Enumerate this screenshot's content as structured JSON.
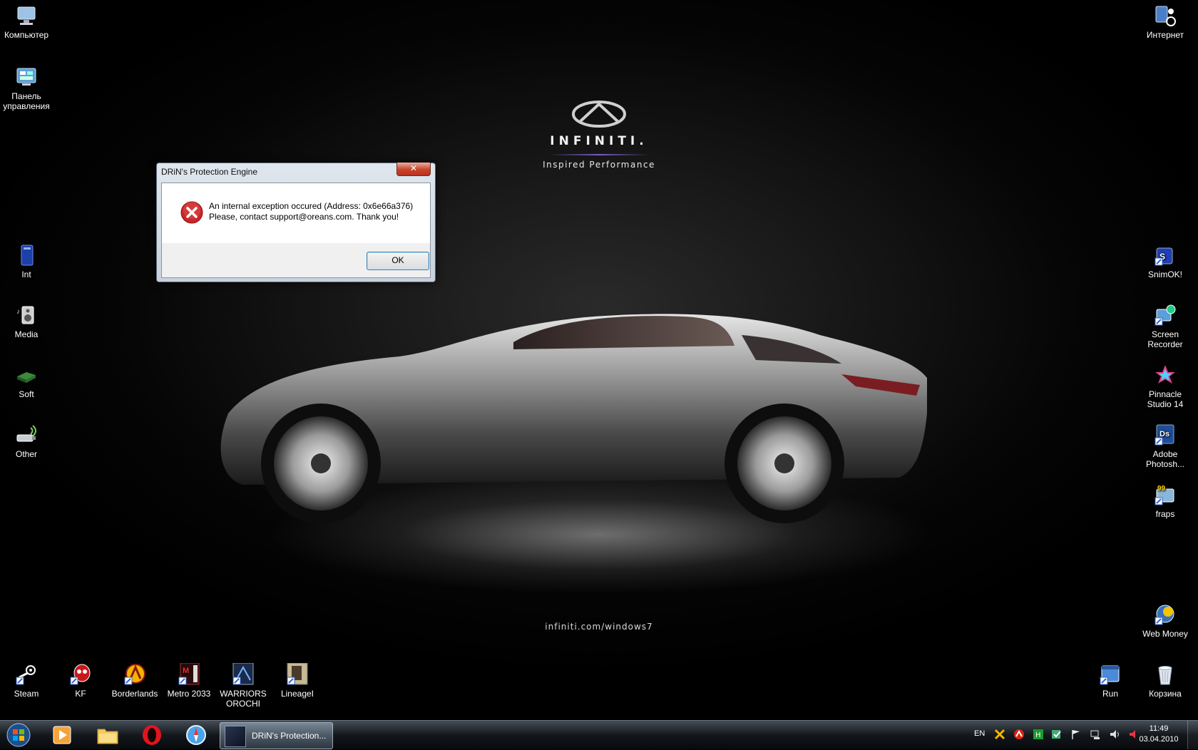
{
  "wallpaper": {
    "brand": "INFINITI.",
    "tagline": "Inspired Performance",
    "url": "infiniti.com/windows7"
  },
  "desktop_icons_left": [
    {
      "label": "Компьютер",
      "icon": "computer-icon"
    },
    {
      "label": "Панель управления",
      "icon": "control-panel-icon"
    },
    {
      "label": "Int",
      "icon": "folder-int-icon"
    },
    {
      "label": "Media",
      "icon": "media-speaker-icon"
    },
    {
      "label": "Soft",
      "icon": "soft-drive-icon"
    },
    {
      "label": "Other",
      "icon": "usb-wireless-icon"
    }
  ],
  "desktop_icons_right": [
    {
      "label": "Интернет",
      "icon": "internet-network-icon"
    },
    {
      "label": "SnimOK!",
      "icon": "snimok-icon"
    },
    {
      "label": "Screen Recorder",
      "icon": "screen-recorder-icon"
    },
    {
      "label": "Pinnacle Studio 14",
      "icon": "pinnacle-studio-icon"
    },
    {
      "label": "Adobe Photosh...",
      "icon": "photoshop-icon"
    },
    {
      "label": "fraps",
      "icon": "fraps-icon"
    },
    {
      "label": "Web Money",
      "icon": "webmoney-icon"
    },
    {
      "label": "Run",
      "icon": "run-icon"
    },
    {
      "label": "Корзина",
      "icon": "recycle-bin-icon"
    }
  ],
  "desktop_icons_bottom": [
    {
      "label": "Steam",
      "icon": "steam-icon"
    },
    {
      "label": "KF",
      "icon": "killing-floor-icon"
    },
    {
      "label": "Borderlands",
      "icon": "borderlands-icon"
    },
    {
      "label": "Metro 2033",
      "icon": "metro-2033-icon"
    },
    {
      "label": "WARRIORS OROCHI",
      "icon": "warriors-orochi-icon"
    },
    {
      "label": "LineageI",
      "icon": "lineage-icon"
    }
  ],
  "dialog": {
    "title": "DRiN's Protection Engine",
    "close_label": "✕",
    "message_line1": "An internal exception occured (Address: 0x6e66a376)",
    "message_line2": "Please, contact support@oreans.com. Thank you!",
    "ok_label": "OK"
  },
  "taskbar": {
    "pinned": [
      "start-orb-icon",
      "media-player-icon",
      "explorer-icon",
      "opera-icon",
      "safari-icon"
    ],
    "active_task_label": "DRiN's Protection...",
    "language": "EN",
    "clock_time": "11:49",
    "clock_date": "03.04.2010"
  },
  "colors": {
    "error_red": "#c8282a",
    "close_button": "#c9432b",
    "ok_border": "#3c7fb1"
  }
}
